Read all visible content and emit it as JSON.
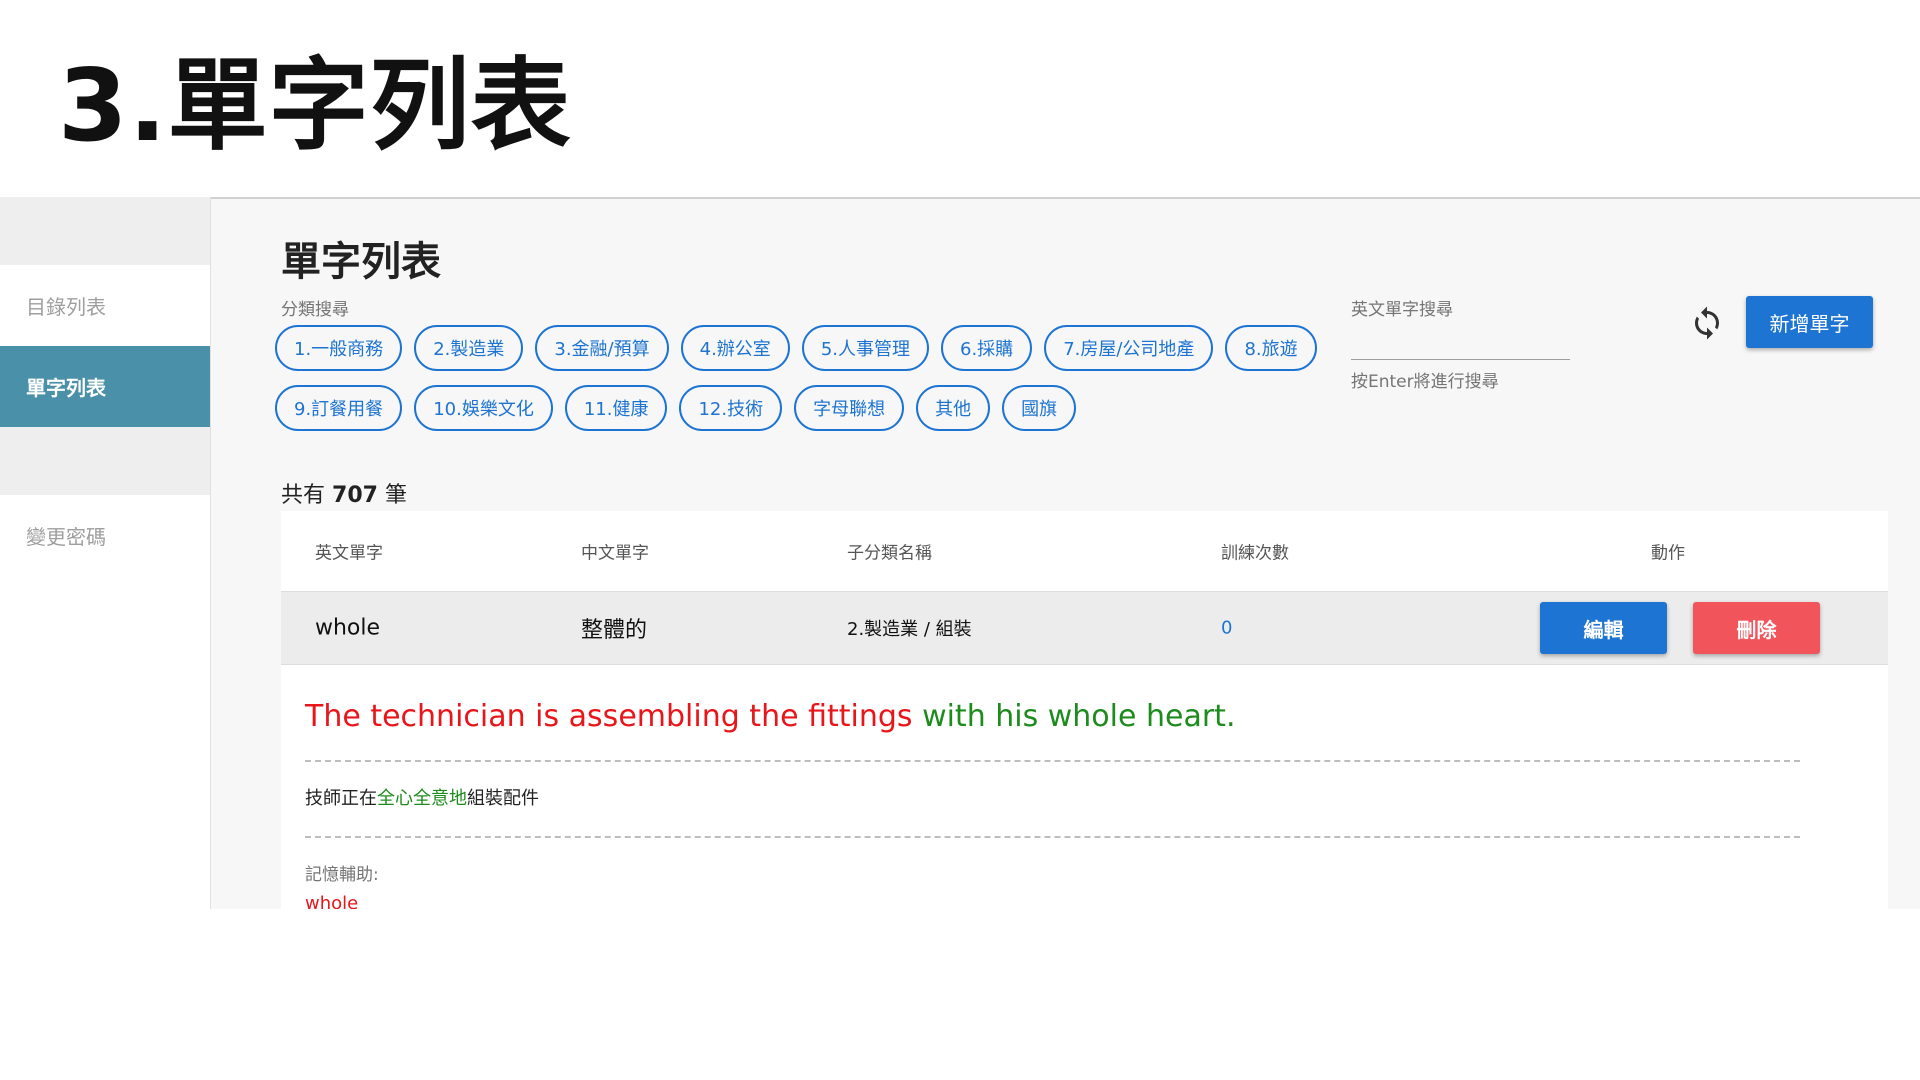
{
  "slide": {
    "title": "3.單字列表"
  },
  "sidebar": {
    "items": [
      {
        "label": "目錄列表"
      },
      {
        "label": "單字列表"
      },
      {
        "label": "變更密碼"
      }
    ]
  },
  "main": {
    "title": "單字列表",
    "filter_label": "分類搜尋",
    "categories_row1": [
      "1.一般商務",
      "2.製造業",
      "3.金融/預算",
      "4.辦公室",
      "5.人事管理",
      "6.採購",
      "7.房屋/公司地產",
      "8.旅遊"
    ],
    "categories_row2": [
      "9.訂餐用餐",
      "10.娛樂文化",
      "11.健康",
      "12.技術",
      "字母聯想",
      "其他",
      "國旗"
    ],
    "search_label": "英文單字搜尋",
    "search_value": "",
    "search_hint": "按Enter將進行搜尋",
    "add_button": "新增單字",
    "count_prefix": "共有",
    "count_value": "707",
    "count_suffix": "筆",
    "columns": [
      "英文單字",
      "中文單字",
      "子分類名稱",
      "訓練次數",
      "動作"
    ],
    "row": {
      "english": "whole",
      "chinese": "整體的",
      "subcategory": "2.製造業 / 組裝",
      "train_count": "0",
      "edit_label": "編輯",
      "delete_label": "刪除"
    },
    "detail": {
      "sentence_part1": "The technician is assembling the fittings ",
      "sentence_part2": "with his whole heart.",
      "zh_part1": "技師正在",
      "zh_part2": "全心全意地",
      "zh_part3": "組裝配件",
      "memo_label": "記憶輔助:",
      "memo_word": "whole"
    }
  },
  "colors": {
    "accent": "#1e74d2",
    "danger": "#f2545b",
    "sidebar_active": "#4a90a8"
  }
}
